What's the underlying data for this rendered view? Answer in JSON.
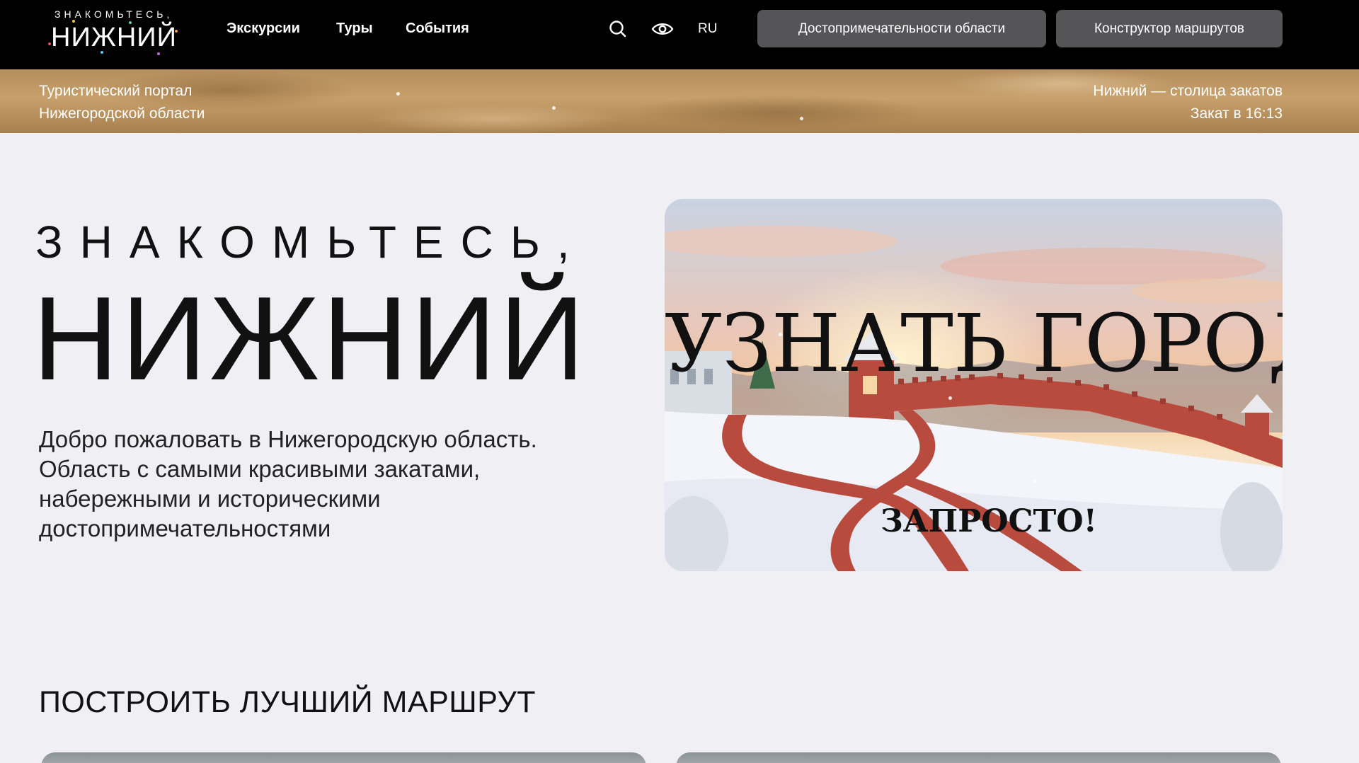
{
  "header": {
    "logo_small": "ЗНАКОМЬТЕСЬ,",
    "logo_big": "НИЖНИЙ",
    "nav": [
      "Экскурсии",
      "Туры",
      "События"
    ],
    "icons": [
      "search-icon",
      "eye-icon"
    ],
    "lang": "RU",
    "btn_attractions": "Достопримечательности области",
    "btn_constructor": "Конструктор маршрутов"
  },
  "strip": {
    "left_line1": "Туристический портал",
    "left_line2": "Нижегородской области",
    "right_line1": "Нижний — столица закатов",
    "right_line2": "Закат в 16:13"
  },
  "hero": {
    "title_top": "ЗНАКОМЬТЕСЬ,",
    "title_big": "НИЖНИЙ",
    "description": "Добро пожаловать в Нижегородскую область. Область с самыми красивыми закатами, набережными и историческими достопримечательностями"
  },
  "banner": {
    "title": "УЗНАТЬ ГОРОД?",
    "subtitle": "ЗАПРОСТО!"
  },
  "section": {
    "title": "ПОСТРОИТЬ ЛУЧШИЙ МАРШРУТ"
  },
  "colors": {
    "header_bg": "#000000",
    "button_bg": "#555457",
    "page_bg": "#f0eff4",
    "kremlin_red": "#b84a3e"
  }
}
